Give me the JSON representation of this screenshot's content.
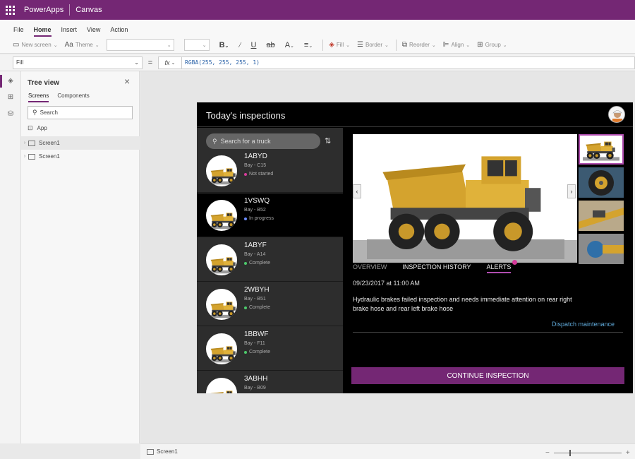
{
  "titlebar": {
    "app_name": "PowerApps",
    "app_type": "Canvas"
  },
  "menu": [
    "File",
    "Home",
    "Insert",
    "View",
    "Action"
  ],
  "menu_active": "Home",
  "toolbar": {
    "new_screen": "New screen",
    "theme": "Theme",
    "fill": "Fill",
    "border": "Border",
    "reorder": "Reorder",
    "align": "Align",
    "group": "Group"
  },
  "formula": {
    "property": "Fill",
    "fx": "fx",
    "value": "RGBA(255, 255, 255, 1)"
  },
  "tree": {
    "title": "Tree view",
    "tabs": [
      "Screens",
      "Components"
    ],
    "search_placeholder": "Search",
    "app_label": "App",
    "screens": [
      "Screen1",
      "Screen1"
    ]
  },
  "app": {
    "title": "Today's inspections",
    "search_placeholder": "Search for a truck",
    "trucks": [
      {
        "id": "1ABYD",
        "bay": "Bay - C15",
        "status": "Not started",
        "status_color": "#d63a9a"
      },
      {
        "id": "1VSWQ",
        "bay": "Bay - B52",
        "status": "In progress",
        "status_color": "#6b8cff"
      },
      {
        "id": "1ABYF",
        "bay": "Bay - A14",
        "status": "Complete",
        "status_color": "#4cc96b"
      },
      {
        "id": "2WBYH",
        "bay": "Bay - B51",
        "status": "Complete",
        "status_color": "#4cc96b"
      },
      {
        "id": "1BBWF",
        "bay": "Bay - F11",
        "status": "Complete",
        "status_color": "#4cc96b"
      },
      {
        "id": "3ABHH",
        "bay": "Bay - B09",
        "status": "",
        "status_color": "#4cc96b"
      }
    ],
    "tabs": [
      "OVERVIEW",
      "INSPECTION HISTORY",
      "ALERTS"
    ],
    "alert_time": "09/23/2017 at 11:00 AM",
    "alert_text": "Hydraulic brakes failed inspection and needs immediate attention on rear right brake hose and rear left brake hose",
    "dispatch": "Dispatch maintenance",
    "continue": "CONTINUE INSPECTION"
  },
  "statusbar": {
    "screen": "Screen1"
  },
  "colors": {
    "brand": "#742774",
    "accent": "#b04db0"
  }
}
